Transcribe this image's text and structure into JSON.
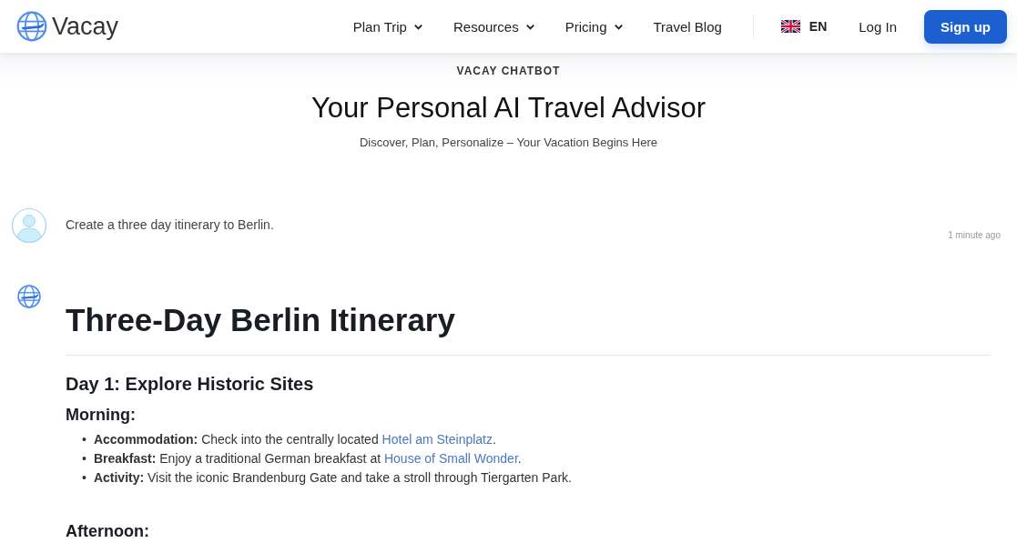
{
  "header": {
    "logo": "Vacay",
    "nav": [
      {
        "label": "Plan Trip",
        "dropdown": true
      },
      {
        "label": "Resources",
        "dropdown": true
      },
      {
        "label": "Pricing",
        "dropdown": true
      },
      {
        "label": "Travel Blog",
        "dropdown": false
      }
    ],
    "language": "EN",
    "login": "Log In",
    "signup": "Sign up"
  },
  "hero": {
    "eyebrow": "VACAY CHATBOT",
    "title": "Your Personal AI Travel Advisor",
    "subtitle": "Discover, Plan, Personalize – Your Vacation Begins Here"
  },
  "messages": [
    {
      "kind": "user",
      "text": "Create a three day itinerary to Berlin.",
      "time": "1 minute ago"
    },
    {
      "kind": "bot",
      "title": "Three-Day Berlin Itinerary",
      "sections": [
        {
          "heading": "Day 1: Explore Historic Sites",
          "parts": [
            {
              "heading": "Morning:",
              "items": [
                {
                  "bullet": "•",
                  "label": "Accommodation:",
                  "text": "Check into the centrally located ",
                  "link": "Hotel am Steinplatz",
                  "after": "."
                },
                {
                  "bullet": "•",
                  "label": "Breakfast:",
                  "text": "Enjoy a traditional German breakfast at ",
                  "link": "House of Small Wonder",
                  "after": "."
                },
                {
                  "bullet": "•",
                  "label": "Activity:",
                  "text": "Visit the iconic Brandenburg Gate and take a stroll through Tiergarten Park."
                }
              ]
            },
            {
              "heading": "Afternoon:"
            }
          ]
        }
      ]
    }
  ]
}
